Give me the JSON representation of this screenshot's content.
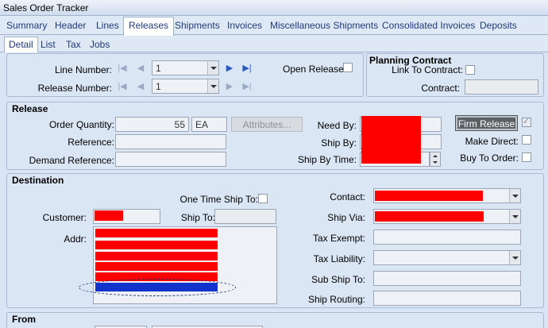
{
  "window": {
    "title": "Sales Order Tracker"
  },
  "tabs": [
    "Summary",
    "Header",
    "Lines",
    "Releases",
    "Shipments",
    "Invoices",
    "Miscellaneous Shipments",
    "Consolidated Invoices",
    "Deposits"
  ],
  "subtabs": [
    "Detail",
    "List",
    "Tax",
    "Jobs"
  ],
  "nav": {
    "line_number_label": "Line Number:",
    "line_number_value": "1",
    "release_number_label": "Release Number:",
    "release_number_value": "1",
    "open_release_label": "Open Release:"
  },
  "planning": {
    "title": "Planning Contract",
    "link_label": "Link To Contract:",
    "contract_label": "Contract:",
    "contract_value": ""
  },
  "release": {
    "title": "Release",
    "order_qty_label": "Order Quantity:",
    "order_qty_value": "55",
    "uom_value": "EA",
    "attributes_button": "Attributes...",
    "reference_label": "Reference:",
    "reference_value": "",
    "demand_ref_label": "Demand Reference:",
    "demand_ref_value": "",
    "need_by_label": "Need By:",
    "ship_by_label": "Ship By:",
    "ship_by_time_label": "Ship By Time:",
    "firm_release_button": "Firm Release",
    "make_direct_label": "Make Direct:",
    "buy_to_order_label": "Buy To Order:"
  },
  "destination": {
    "title": "Destination",
    "one_time_ship_label": "One Time Ship To:",
    "customer_label": "Customer:",
    "ship_to_label": "Ship To:",
    "ship_to_value": "",
    "addr_label": "Addr:",
    "contact_label": "Contact:",
    "ship_via_label": "Ship Via:",
    "tax_exempt_label": "Tax Exempt:",
    "tax_exempt_value": "",
    "tax_liability_label": "Tax Liability:",
    "tax_liability_value": "",
    "sub_ship_to_label": "Sub Ship To:",
    "sub_ship_to_value": "",
    "ship_routing_label": "Ship Routing:",
    "ship_routing_value": ""
  },
  "from": {
    "title": "From"
  },
  "colors": {
    "redaction": "#ff0000",
    "highlight": "#1133cc",
    "active_tab": "#ffffff",
    "panel": "#dbe6f4"
  },
  "icons": [
    "first-record-icon",
    "prev-record-icon",
    "next-record-icon",
    "last-record-icon",
    "chevron-down-icon",
    "spinner-icon",
    "checkbox-icon"
  ]
}
